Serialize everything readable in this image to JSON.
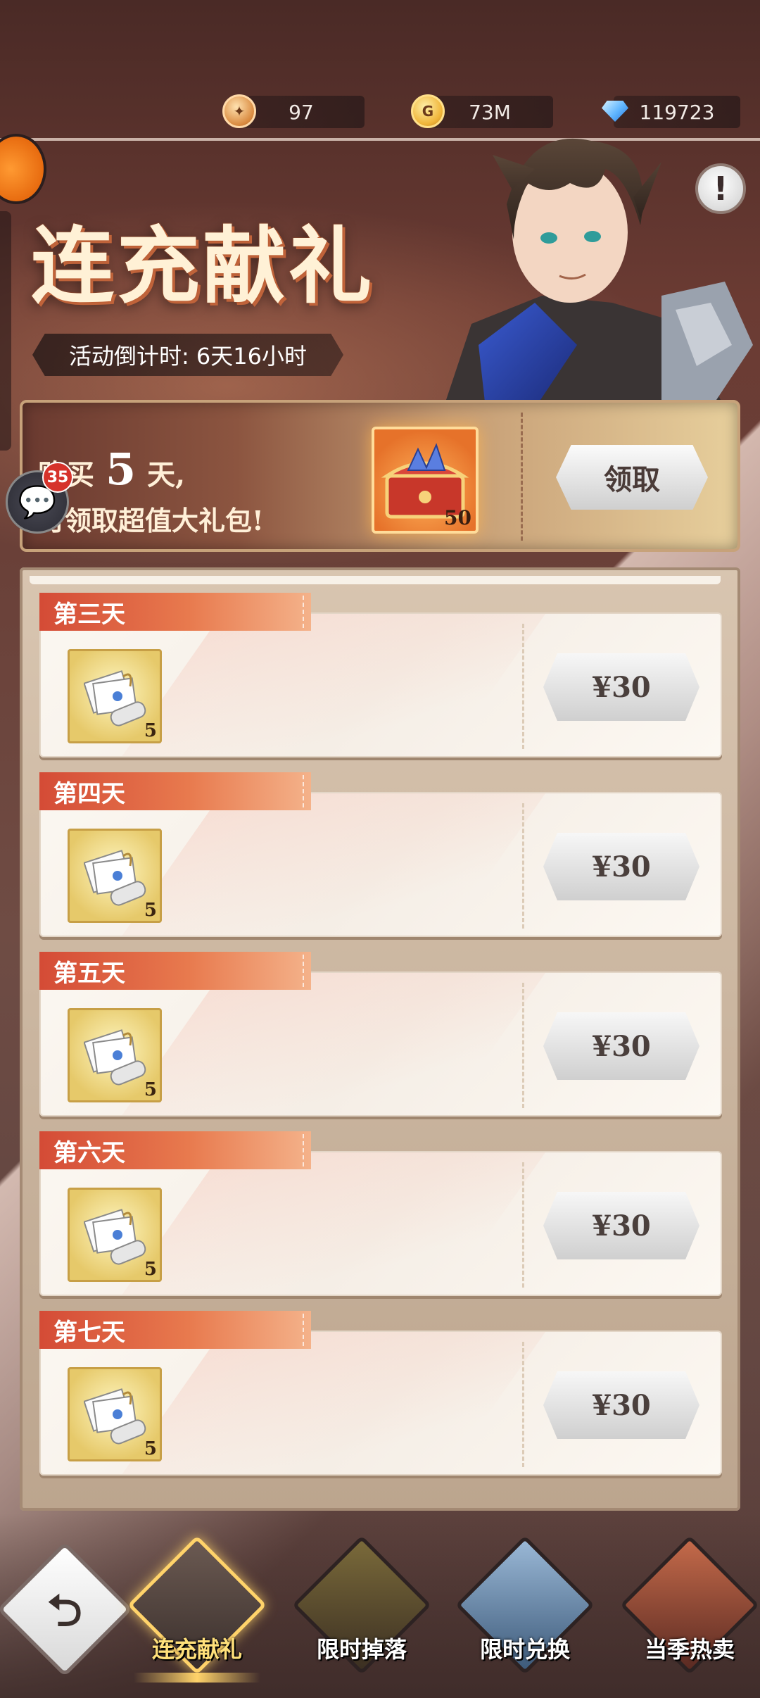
{
  "resources": [
    {
      "icon": "ticket-icon",
      "value": "97"
    },
    {
      "icon": "gold-coin-icon",
      "value": "73M"
    },
    {
      "icon": "diamond-gem-icon",
      "value": "119723"
    }
  ],
  "event": {
    "title": "连充献礼",
    "countdown": "活动倒计时: 6天16小时"
  },
  "chat": {
    "badge_count": "35"
  },
  "banner": {
    "line1_prefix": "购买",
    "line1_number": "5",
    "line1_suffix": "天,",
    "line2": "可领取超值大礼包!",
    "reward_count": "50",
    "claim_label": "领取"
  },
  "days": [
    {
      "label": "第三天",
      "item_count": "5",
      "price": "¥30"
    },
    {
      "label": "第四天",
      "item_count": "5",
      "price": "¥30"
    },
    {
      "label": "第五天",
      "item_count": "5",
      "price": "¥30"
    },
    {
      "label": "第六天",
      "item_count": "5",
      "price": "¥30"
    },
    {
      "label": "第七天",
      "item_count": "5",
      "price": "¥30"
    }
  ],
  "nav": {
    "tabs": [
      {
        "label": "连充献礼",
        "active": true
      },
      {
        "label": "限时掉落",
        "active": false
      },
      {
        "label": "限时兑换",
        "active": false
      },
      {
        "label": "当季热卖",
        "active": false
      }
    ]
  },
  "colors": {
    "tag_red": "#d44b36",
    "active_tab_text": "#ffe07a",
    "badge_red": "#d6322b"
  }
}
